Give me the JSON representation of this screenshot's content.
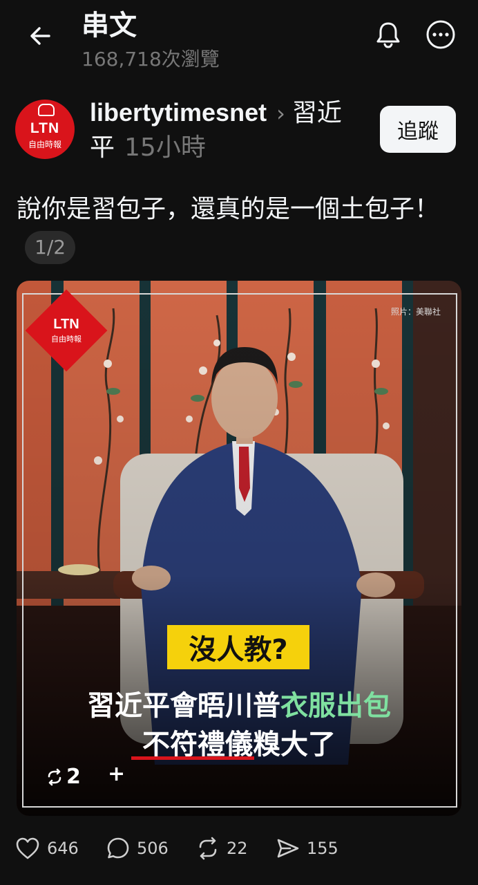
{
  "header": {
    "title": "串文",
    "views": "168,718次瀏覽"
  },
  "post": {
    "avatar": {
      "logo_text": "LTN",
      "logo_sub": "自由時報"
    },
    "author": "libertytimesnet",
    "topic": "習近平",
    "time": "15小時",
    "follow_label": "追蹤",
    "text": "說你是習包子，還真的是一個土包子！",
    "page_indicator": "1/2"
  },
  "image": {
    "credit": "照片：美聯社",
    "badge_text": "LTN",
    "badge_sub": "自由時報",
    "box_text": "沒人教?",
    "line1_white": "習近平會晤川普",
    "line1_green": "衣服出包",
    "line2": "不符禮儀糗大了",
    "repost_count": "2",
    "plus": "+"
  },
  "actions": {
    "likes": "646",
    "replies": "506",
    "reposts": "22",
    "shares": "155"
  },
  "colors": {
    "background": "#101010",
    "brand_red": "#d9141b",
    "highlight_yellow": "#f5d10c",
    "highlight_green": "#7fe0a0"
  }
}
